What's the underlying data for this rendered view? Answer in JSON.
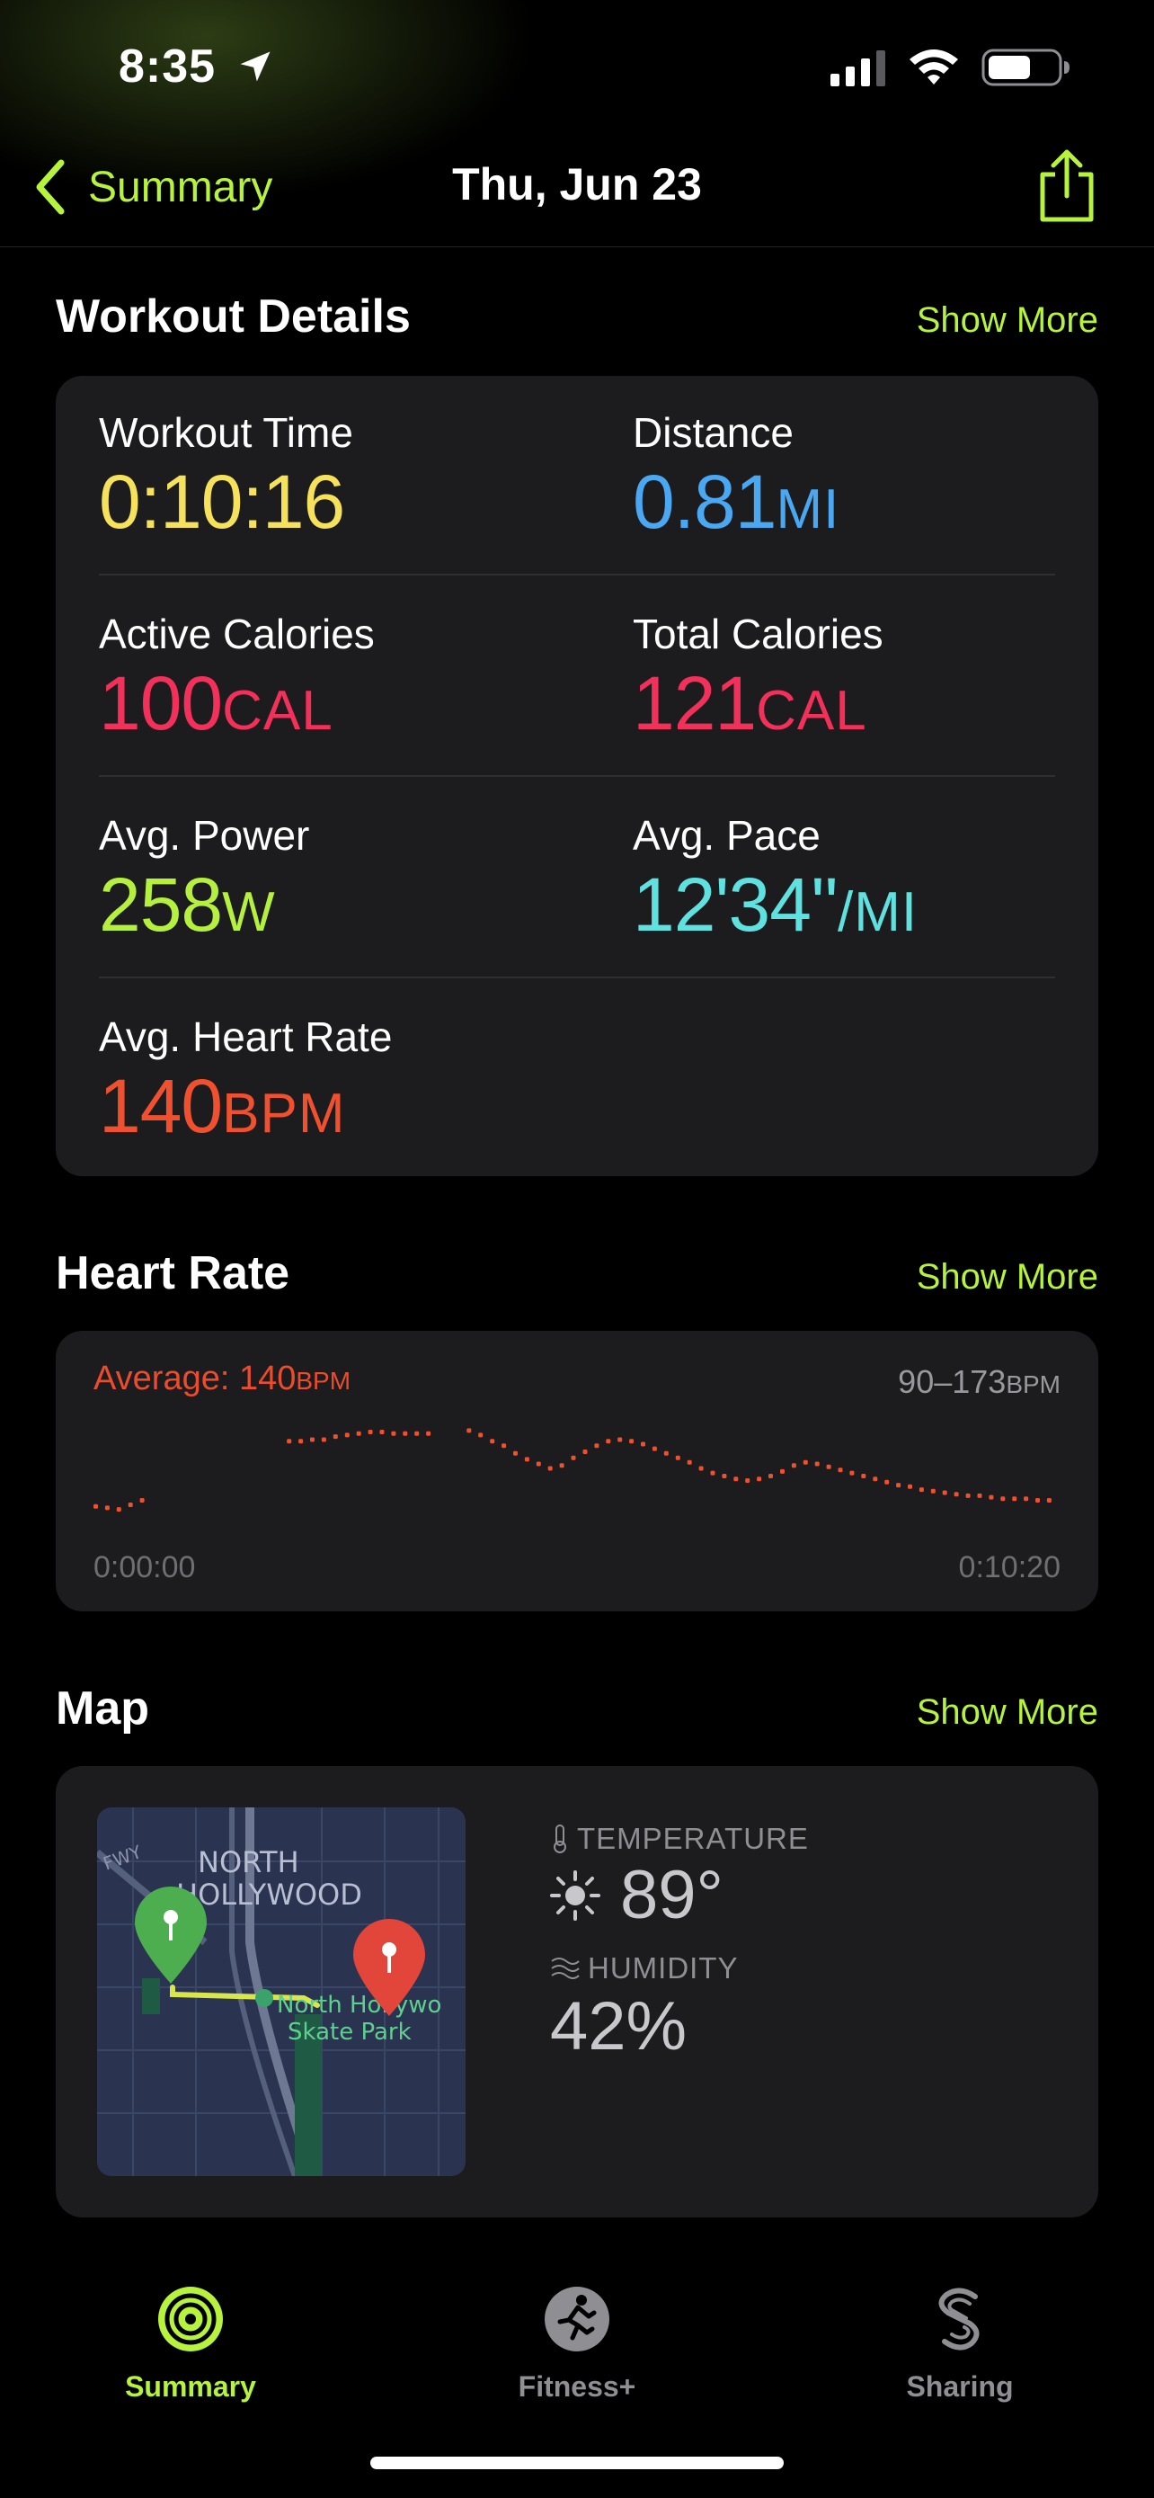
{
  "status_bar": {
    "time": "8:35"
  },
  "nav": {
    "back_label": "Summary",
    "title": "Thu, Jun 23"
  },
  "workout_details": {
    "title": "Workout Details",
    "show_more": "Show More",
    "metrics": [
      {
        "label": "Workout Time",
        "value": "0:10:16",
        "unit": "",
        "color": "#f5e15a"
      },
      {
        "label": "Distance",
        "value": "0.81",
        "unit": "MI",
        "color": "#4aa8f2"
      },
      {
        "label": "Active Calories",
        "value": "100",
        "unit": "CAL",
        "color": "#f2305a"
      },
      {
        "label": "Total Calories",
        "value": "121",
        "unit": "CAL",
        "color": "#f2305a"
      },
      {
        "label": "Avg. Power",
        "value": "258",
        "unit": "W",
        "color": "#b6f03e"
      },
      {
        "label": "Avg. Pace",
        "value": "12'34''",
        "unit": "/MI",
        "color": "#5fe1e0"
      },
      {
        "label": "Avg. Heart Rate",
        "value": "140",
        "unit": "BPM",
        "color": "#f0502e"
      }
    ]
  },
  "heart_rate": {
    "title": "Heart Rate",
    "show_more": "Show More",
    "average_label": "Average: 140",
    "average_unit": "BPM",
    "range": "90–173",
    "range_unit": "BPM",
    "start_time": "0:00:00",
    "end_time": "0:10:20",
    "y_range": [
      90,
      173
    ],
    "points": [
      [
        0.0,
        105
      ],
      [
        0.012,
        104
      ],
      [
        0.024,
        103
      ],
      [
        0.036,
        106
      ],
      [
        0.048,
        109
      ],
      [
        0.2,
        148
      ],
      [
        0.212,
        148
      ],
      [
        0.224,
        149
      ],
      [
        0.236,
        149
      ],
      [
        0.248,
        151
      ],
      [
        0.26,
        152
      ],
      [
        0.272,
        153
      ],
      [
        0.284,
        154
      ],
      [
        0.296,
        154
      ],
      [
        0.308,
        153
      ],
      [
        0.32,
        153
      ],
      [
        0.332,
        153
      ],
      [
        0.344,
        153
      ],
      [
        0.386,
        155
      ],
      [
        0.398,
        152
      ],
      [
        0.41,
        148
      ],
      [
        0.422,
        145
      ],
      [
        0.434,
        140
      ],
      [
        0.446,
        136
      ],
      [
        0.458,
        133
      ],
      [
        0.47,
        130
      ],
      [
        0.482,
        132
      ],
      [
        0.494,
        137
      ],
      [
        0.506,
        141
      ],
      [
        0.518,
        145
      ],
      [
        0.53,
        148
      ],
      [
        0.542,
        149
      ],
      [
        0.554,
        148
      ],
      [
        0.566,
        146
      ],
      [
        0.578,
        143
      ],
      [
        0.59,
        140
      ],
      [
        0.602,
        137
      ],
      [
        0.614,
        134
      ],
      [
        0.626,
        130
      ],
      [
        0.638,
        127
      ],
      [
        0.65,
        125
      ],
      [
        0.662,
        123
      ],
      [
        0.674,
        122
      ],
      [
        0.686,
        123
      ],
      [
        0.698,
        125
      ],
      [
        0.71,
        128
      ],
      [
        0.722,
        132
      ],
      [
        0.734,
        134
      ],
      [
        0.746,
        133
      ],
      [
        0.758,
        131
      ],
      [
        0.77,
        129
      ],
      [
        0.782,
        127
      ],
      [
        0.794,
        125
      ],
      [
        0.806,
        123
      ],
      [
        0.818,
        121
      ],
      [
        0.83,
        119
      ],
      [
        0.842,
        118
      ],
      [
        0.854,
        116
      ],
      [
        0.866,
        115
      ],
      [
        0.878,
        114
      ],
      [
        0.89,
        113
      ],
      [
        0.902,
        112
      ],
      [
        0.914,
        112
      ],
      [
        0.926,
        111
      ],
      [
        0.938,
        110
      ],
      [
        0.95,
        110
      ],
      [
        0.962,
        110
      ],
      [
        0.974,
        109
      ],
      [
        0.986,
        109
      ]
    ]
  },
  "map": {
    "title": "Map",
    "show_more": "Show More",
    "area_label_1": "NORTH",
    "area_label_2": "HOLLYWOOD",
    "road_label": "FWY",
    "poi_label_1": "North Hollywo",
    "poi_label_2": "Skate Park",
    "temperature_label": "TEMPERATURE",
    "temperature_value": "89°",
    "humidity_label": "HUMIDITY",
    "humidity_value": "42%"
  },
  "tabs": [
    {
      "label": "Summary",
      "active": true
    },
    {
      "label": "Fitness+",
      "active": false
    },
    {
      "label": "Sharing",
      "active": false
    }
  ]
}
